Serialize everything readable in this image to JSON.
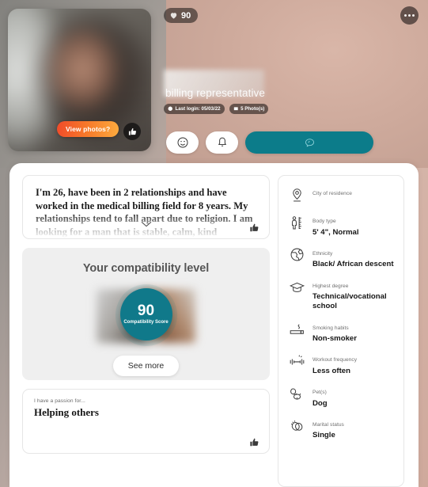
{
  "hero": {
    "score_badge": {
      "icon": "heart-icon",
      "value": "90"
    },
    "more_menu": "more-options",
    "job_title": "billing representative",
    "chips": [
      {
        "icon": "clock-icon",
        "label": "Last login: 05/03/22"
      },
      {
        "icon": "photo-icon",
        "label": "5 Photo(s)"
      }
    ],
    "photo": {
      "view_photos_label": "View photos?",
      "like_icon": "thumbs-up-icon"
    },
    "actions": [
      {
        "name": "wink-button",
        "icon": "winking-face-icon"
      },
      {
        "name": "nudge-button",
        "icon": "bell-icon"
      },
      {
        "name": "message-button",
        "icon": "chat-bubble-icon"
      }
    ]
  },
  "bio": {
    "text": "I'm 26, have been in 2 relationships and have worked in the medical billing field for 8 years. My relationships tend to fall apart due to religion. I am looking for a man that is stable, calm, kind",
    "expand_icon": "chevron-down-icon",
    "like_icon": "thumbs-up-icon"
  },
  "compatibility": {
    "title": "Your compatibility level",
    "score": "90",
    "score_label": "Compatibility Score",
    "see_more_label": "See more",
    "accent_color": "#10798a"
  },
  "passion": {
    "label": "I have a passion for...",
    "value": "Helping others",
    "like_icon": "thumbs-up-icon"
  },
  "details": [
    {
      "icon": "location-pin-icon",
      "label": "City of residence",
      "value": "",
      "redacted": true
    },
    {
      "icon": "body-ruler-icon",
      "label": "Body type",
      "value": "5' 4\", Normal"
    },
    {
      "icon": "globe-icon",
      "label": "Ethnicity",
      "value": "Black/ African descent"
    },
    {
      "icon": "graduation-cap-icon",
      "label": "Highest degree",
      "value": "Technical/vocational school"
    },
    {
      "icon": "cigarette-icon",
      "label": "Smoking habits",
      "value": "Non-smoker"
    },
    {
      "icon": "dumbbell-icon",
      "label": "Workout frequency",
      "value": "Less often"
    },
    {
      "icon": "pets-icon",
      "label": "Pet(s)",
      "value": "Dog"
    },
    {
      "icon": "rings-icon",
      "label": "Marital status",
      "value": "Single"
    }
  ]
}
